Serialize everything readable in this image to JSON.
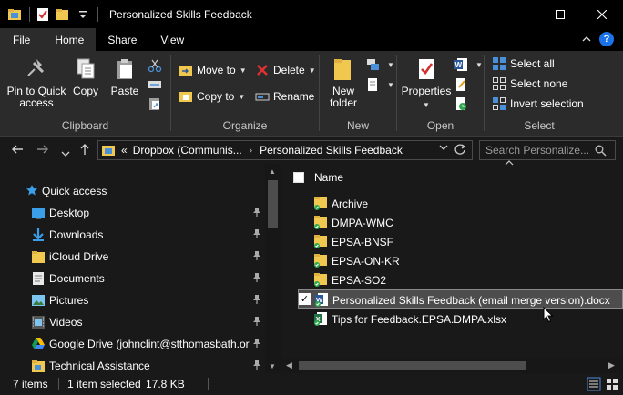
{
  "window": {
    "title": "Personalized Skills Feedback",
    "minimize": "—",
    "maximize": "☐",
    "close": "✕"
  },
  "tabs": [
    "File",
    "Home",
    "Share",
    "View"
  ],
  "ribbon": {
    "clipboard": {
      "label": "Clipboard",
      "pin": [
        "Pin to Quick",
        "access"
      ],
      "copy": "Copy",
      "paste": "Paste"
    },
    "organize": {
      "label": "Organize",
      "move_to": "Move to",
      "copy_to": "Copy to",
      "delete": "Delete",
      "rename": "Rename"
    },
    "new": {
      "label": "New",
      "new_folder": [
        "New",
        "folder"
      ]
    },
    "open": {
      "label": "Open",
      "properties": "Properties"
    },
    "select": {
      "label": "Select",
      "select_all": "Select all",
      "select_none": "Select none",
      "invert": "Invert selection"
    }
  },
  "address": {
    "prefix": "«",
    "crumbs": [
      "Dropbox (Communis...",
      "Personalized Skills Feedback"
    ],
    "search_placeholder": "Search Personalize..."
  },
  "nav": {
    "quick_access": "Quick access",
    "items": [
      {
        "label": "Desktop",
        "icon": "desktop-icon",
        "pinned": true
      },
      {
        "label": "Downloads",
        "icon": "downloads-icon",
        "pinned": true
      },
      {
        "label": "iCloud Drive",
        "icon": "folder-icon",
        "pinned": true
      },
      {
        "label": "Documents",
        "icon": "documents-icon",
        "pinned": true
      },
      {
        "label": "Pictures",
        "icon": "pictures-icon",
        "pinned": true
      },
      {
        "label": "Videos",
        "icon": "videos-icon",
        "pinned": true
      },
      {
        "label": "Google Drive (johnclint@stthomasbath.or",
        "icon": "google-drive-icon",
        "pinned": true
      },
      {
        "label": "Technical Assistance",
        "icon": "folder-icon",
        "pinned": true
      }
    ]
  },
  "content": {
    "column_name": "Name",
    "files": [
      {
        "name": "Archive",
        "type": "folder",
        "selected": false
      },
      {
        "name": "DMPA-WMC",
        "type": "folder",
        "selected": false
      },
      {
        "name": "EPSA-BNSF",
        "type": "folder",
        "selected": false
      },
      {
        "name": "EPSA-ON-KR",
        "type": "folder",
        "selected": false
      },
      {
        "name": "EPSA-SO2",
        "type": "folder",
        "selected": false
      },
      {
        "name": "Personalized Skills Feedback (email merge version).docx",
        "type": "docx",
        "selected": true
      },
      {
        "name": "Tips for Feedback.EPSA.DMPA.xlsx",
        "type": "xlsx",
        "selected": false
      }
    ]
  },
  "status": {
    "items": "7 items",
    "selected": "1 item selected",
    "size": "17.8 KB"
  },
  "colors": {
    "background": "#191919",
    "ribbon": "#2b2b2b",
    "titlebar": "#000000",
    "folder": "#f0c850",
    "sync_green": "#2fa84f",
    "word_blue": "#2b579a",
    "excel_green": "#217346",
    "accent_blue": "#1a73e8"
  }
}
